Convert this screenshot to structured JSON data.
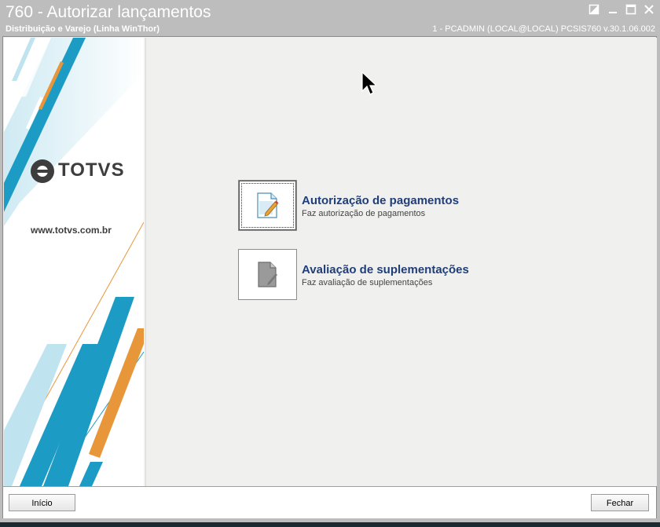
{
  "window": {
    "title": "760 - Autorizar lançamentos",
    "subtitle": "Distribuição e Varejo (Linha WinThor)",
    "user_info": "1 - PCADMIN (LOCAL@LOCAL)   PCSIS760  v.30.1.06.002",
    "controls": [
      "restore-icon",
      "minimize-icon",
      "maximize-icon",
      "close-icon"
    ]
  },
  "banner": {
    "brand": "TOTVS",
    "website": "www.totvs.com.br",
    "colors": {
      "blue": "#1c9cc4",
      "orange": "#e8963a",
      "light_blue": "#bfe3ef"
    }
  },
  "options": [
    {
      "title": "Autorização de pagamentos",
      "description": "Faz autorização de pagamentos",
      "icon": "document-edit-icon"
    },
    {
      "title": "Avaliação de suplementações",
      "description": "Faz avaliação de suplementações",
      "icon": "document-gray-icon"
    }
  ],
  "footer": {
    "start_label": "Início",
    "close_label": "Fechar"
  }
}
